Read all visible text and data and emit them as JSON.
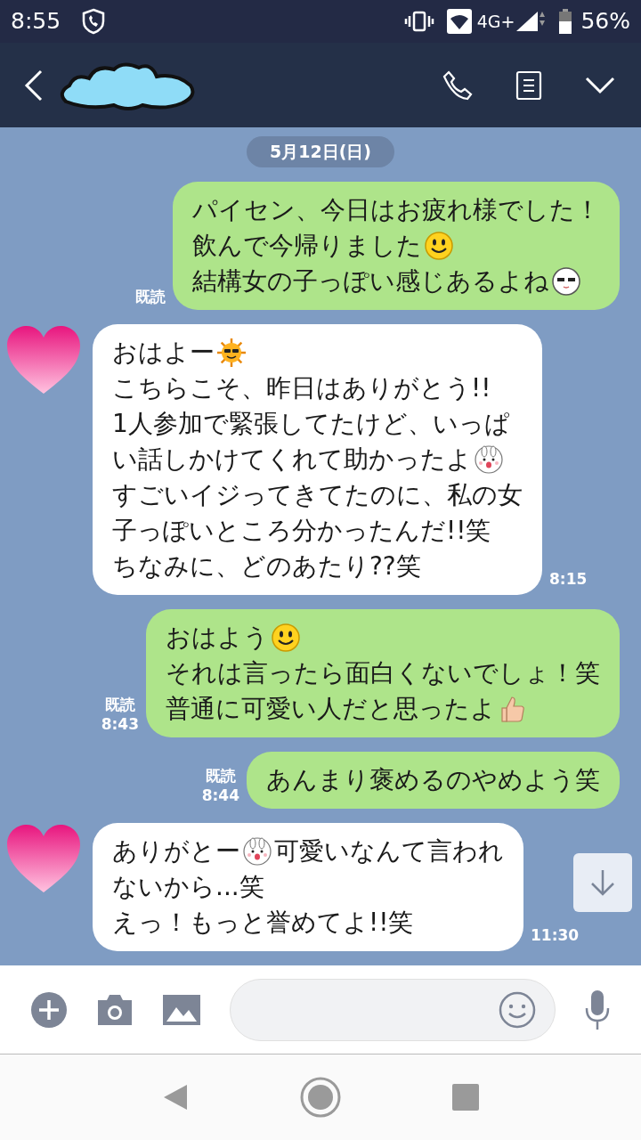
{
  "status_bar": {
    "time": "8:55",
    "network": "4G+",
    "battery": "56%"
  },
  "date": "5月12日(日)",
  "messages": [
    {
      "kind": "sent",
      "read": "既読",
      "lines": [
        [
          {
            "kind": "text",
            "text": "パイセン、今日はお疲れ様でした！"
          }
        ],
        [
          {
            "kind": "text",
            "text": "飲んで今帰りました"
          },
          {
            "kind": "smiley"
          }
        ],
        [
          {
            "kind": "text",
            "text": "結構女の子っぽい感じあるよね"
          },
          {
            "kind": "shades-face"
          }
        ]
      ]
    },
    {
      "kind": "received",
      "time": "8:15",
      "lines": [
        [
          {
            "kind": "text",
            "text": "おはよー"
          },
          {
            "kind": "sun"
          }
        ],
        [
          {
            "kind": "text",
            "text": "こちらこそ、昨日はありがとう!!"
          }
        ],
        [
          {
            "kind": "text",
            "text": "1人参加で緊張してたけど、いっぱ"
          }
        ],
        [
          {
            "kind": "text",
            "text": "い話しかけてくれて助かったよ"
          },
          {
            "kind": "bunny"
          }
        ],
        [
          {
            "kind": "text",
            "text": "すごいイジってきてたのに、私の女"
          }
        ],
        [
          {
            "kind": "text",
            "text": "子っぽいところ分かったんだ!!笑"
          }
        ],
        [
          {
            "kind": "text",
            "text": "ちなみに、どのあたり??笑"
          }
        ]
      ]
    },
    {
      "kind": "sent",
      "read": "既読",
      "time": "8:43",
      "lines": [
        [
          {
            "kind": "text",
            "text": "おはよう "
          },
          {
            "kind": "smiley"
          }
        ],
        [
          {
            "kind": "text",
            "text": "それは言ったら面白くないでしょ！笑"
          }
        ],
        [
          {
            "kind": "text",
            "text": "普通に可愛い人だと思ったよ"
          },
          {
            "kind": "thumbs-up"
          }
        ]
      ]
    },
    {
      "kind": "sent",
      "read": "既読",
      "time": "8:44",
      "lines": [
        [
          {
            "kind": "text",
            "text": "あんまり褒めるのやめよう笑"
          }
        ]
      ]
    },
    {
      "kind": "received",
      "time": "11:30",
      "lines": [
        [
          {
            "kind": "text",
            "text": "ありがとー"
          },
          {
            "kind": "bunny"
          },
          {
            "kind": "text",
            "text": "可愛いなんて言われ"
          }
        ],
        [
          {
            "kind": "text",
            "text": "ないから...笑"
          }
        ],
        [
          {
            "kind": "text",
            "text": "えっ！もっと誉めてよ!!笑"
          }
        ]
      ]
    }
  ]
}
